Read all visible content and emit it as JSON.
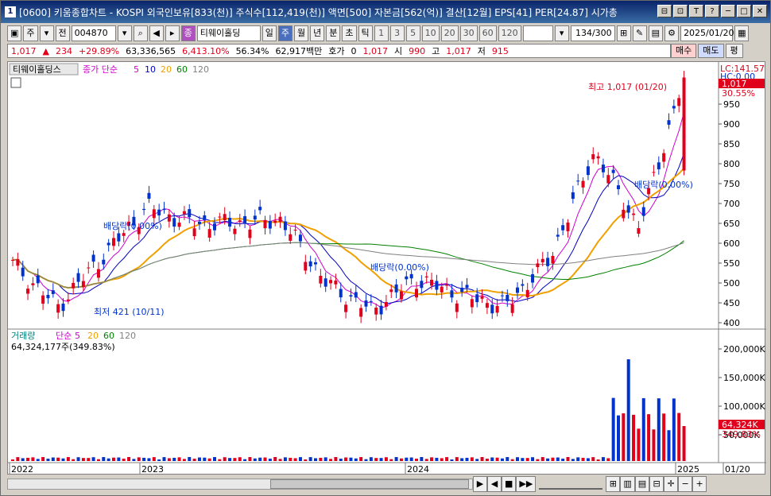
{
  "title": "[0600] 키움종합차트 - KOSPI 외국인보유[833(천)] 주식수[112,419(천)] 액면[500] 자본금[562(억)] 결산[12월] EPS[41] PER[24.87] 시가총",
  "titlebar": {
    "app_icon": "1",
    "buttons": [
      "⊟",
      "⊡",
      "T",
      "?",
      "─",
      "□",
      "✕"
    ]
  },
  "toolbar": {
    "market": "주",
    "market2": "전",
    "code": "004870",
    "company": "티웨이홀딩",
    "company_badge": "종",
    "periods": [
      "일",
      "주",
      "월",
      "년",
      "분",
      "초",
      "틱"
    ],
    "selected_period": "주",
    "intervals": [
      "1",
      "3",
      "5",
      "10",
      "20",
      "30",
      "60",
      "120"
    ],
    "count": "134",
    "count_max": "/300",
    "date": "2025/01/20"
  },
  "pricebar": {
    "price": "1,017",
    "change": "234",
    "change_pct": "+29.89%",
    "volume": "63,336,565",
    "volume_pct": "6,413.10%",
    "ratio": "56.34%",
    "amount": "62,917백만",
    "hoga_label": "호가",
    "hoga_value": "0",
    "hoga_price": "1,017",
    "open_label": "시",
    "open": "990",
    "high_label": "고",
    "high": "1,017",
    "low_label": "저",
    "low": "915",
    "buy": "매수",
    "sell": "매도",
    "eval": "평"
  },
  "chart_legend": {
    "name": "티웨이홀딩스",
    "ma_label": "종가 단순",
    "ma_periods": [
      "5",
      "10",
      "20",
      "60",
      "120"
    ],
    "volume_label": "거래량",
    "vol_ma_label": "단순",
    "vol_ma_periods": [
      "5",
      "20",
      "60",
      "120"
    ],
    "volume_value": "64,324,177주(349.83%)"
  },
  "annotations": {
    "lc": "LC:141.57",
    "hc": "HC:0.00",
    "current_price": "1,017",
    "current_pct": "30.55%",
    "high_note": "최고 1,017 (01/20)",
    "low_note": "최저 421 (10/11)",
    "dividend1": "배당락(0.00%)",
    "dividend2": "배당락(0.00%)",
    "dividend3": "배당락(0.00%)",
    "vol_current": "64,324K",
    "vol_pct": "349.83%"
  },
  "chart_data": {
    "type": "candlestick",
    "price_axis": [
      "950",
      "900",
      "850",
      "800",
      "750",
      "700",
      "650",
      "600",
      "550",
      "500",
      "450",
      "400"
    ],
    "volume_axis": [
      "200,000K",
      "150,000K",
      "100,000K",
      "50,000K"
    ],
    "x_labels": [
      "2022",
      "2023",
      "2024",
      "2025",
      "01/20"
    ],
    "ylim": [
      380,
      1040
    ],
    "ma_colors": {
      "5": "#d000d0",
      "10": "#0000c0",
      "20": "#f0a000",
      "60": "#008000",
      "120": "#808080"
    },
    "price_series_approx": [
      {
        "x": "2022-09",
        "open": 560,
        "close": 548
      },
      {
        "x": "2022-10",
        "open": 470,
        "close": 440
      },
      {
        "x": "2022-12",
        "open": 530,
        "close": 565
      },
      {
        "x": "2023-01",
        "open": 600,
        "close": 690
      },
      {
        "x": "2023-02",
        "open": 690,
        "close": 650
      },
      {
        "x": "2023-04",
        "open": 580,
        "close": 650
      },
      {
        "x": "2023-06",
        "open": 640,
        "close": 660
      },
      {
        "x": "2023-08",
        "open": 600,
        "close": 500
      },
      {
        "x": "2023-10",
        "open": 470,
        "close": 430
      },
      {
        "x": "2024-01",
        "open": 490,
        "close": 510
      },
      {
        "x": "2024-04",
        "open": 500,
        "close": 470
      },
      {
        "x": "2024-07",
        "open": 460,
        "close": 440
      },
      {
        "x": "2024-09",
        "open": 520,
        "close": 560
      },
      {
        "x": "2024-11",
        "open": 560,
        "close": 830
      },
      {
        "x": "2024-12",
        "open": 700,
        "close": 640
      },
      {
        "x": "2025-01",
        "open": 783,
        "close": 1017
      }
    ]
  },
  "statusbar": {
    "nav": [
      "▶",
      "◀",
      "■",
      "▶▶"
    ],
    "zoom": [
      "−",
      "+"
    ]
  }
}
